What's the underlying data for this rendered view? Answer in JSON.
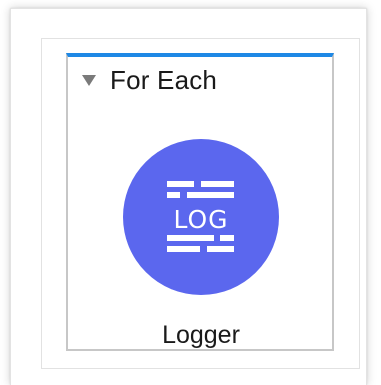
{
  "scope": {
    "title": "For Each",
    "accent_color": "#1e88e5"
  },
  "component": {
    "icon_text": "LOG",
    "label": "Logger",
    "color": "#5b67ee",
    "icon": "logger-icon"
  }
}
